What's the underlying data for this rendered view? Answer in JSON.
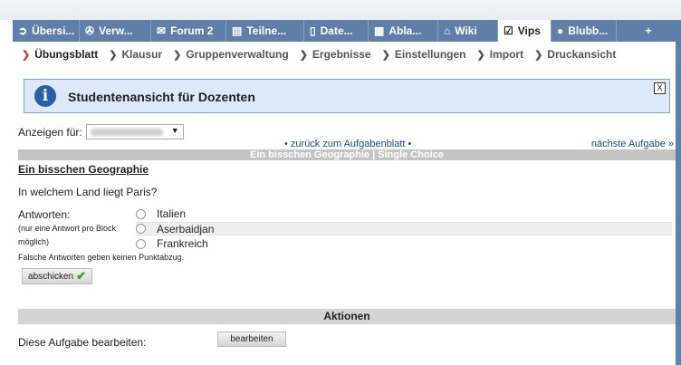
{
  "tabs": [
    {
      "label": "Übersi...",
      "icon": "overview-icon",
      "glyph": "➲",
      "width": 74
    },
    {
      "label": "Verw...",
      "icon": "admin-icon",
      "glyph": "✇",
      "width": 79
    },
    {
      "label": "Forum 2",
      "icon": "forum-icon",
      "glyph": "✉",
      "width": 83
    },
    {
      "label": "Teilne...",
      "icon": "participants-icon",
      "glyph": "▤",
      "width": 86
    },
    {
      "label": "Date...",
      "icon": "files-icon",
      "glyph": "▯",
      "width": 71
    },
    {
      "label": "Abla...",
      "icon": "calendar-icon",
      "glyph": "▦",
      "width": 77
    },
    {
      "label": "Wiki",
      "icon": "wiki-icon",
      "glyph": "⌂",
      "width": 66
    },
    {
      "label": "Vips",
      "icon": "vips-checkbox-icon",
      "glyph": "☑",
      "width": 59,
      "active": true
    },
    {
      "label": "Blubb...",
      "icon": "blubber-icon",
      "glyph": "●",
      "width": 72
    },
    {
      "label": "+",
      "icon": "",
      "glyph": "",
      "width": 71
    }
  ],
  "subnav": [
    {
      "label": "Übungsblatt",
      "active": true
    },
    {
      "label": "Klausur"
    },
    {
      "label": "Gruppenverwaltung"
    },
    {
      "label": "Ergebnisse"
    },
    {
      "label": "Einstellungen"
    },
    {
      "label": "Import"
    },
    {
      "label": "Druckansicht"
    }
  ],
  "info": {
    "title": "Studentenansicht für Dozenten",
    "close": "X"
  },
  "show_for": {
    "label": "Anzeigen für:"
  },
  "nav": {
    "back": "• zurück zum Aufgabenblatt •",
    "next": "nächste Aufgabe »"
  },
  "sheet_title": "Ein bisschen Geographie | Single Choice",
  "question": {
    "title": "Ein bisschen Geographie",
    "text": "In welchem Land liegt Paris?",
    "answers_label": "Antworten:",
    "answers_note": "(nur eine Antwort pro Block möglich)",
    "options": [
      "Italien",
      "Aserbaidjan",
      "Frankreich"
    ],
    "penalty_note": "Falsche Antworten geben keinen Punktabzug.",
    "submit_label": "abschicken"
  },
  "actions": {
    "header": "Aktionen",
    "edit_label": "Diese Aufgabe bearbeiten:",
    "edit_button": "bearbeiten"
  }
}
